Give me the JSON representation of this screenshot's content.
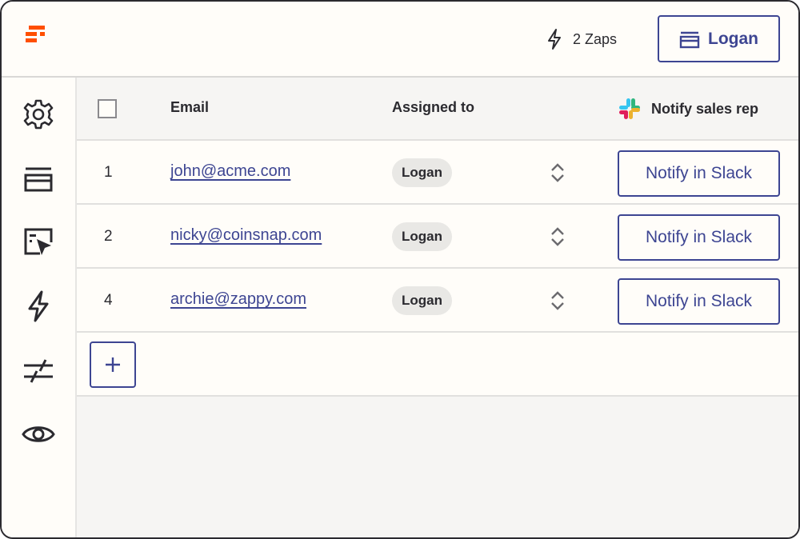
{
  "header": {
    "zaps_label": "2 Zaps",
    "user_label": "Logan",
    "brand_color": "#ff4f00",
    "accent_color": "#3d4592"
  },
  "sidebar": {
    "items": [
      {
        "icon": "gear-icon"
      },
      {
        "icon": "tables-icon"
      },
      {
        "icon": "interfaces-icon"
      },
      {
        "icon": "zap-icon"
      },
      {
        "icon": "transfer-icon"
      },
      {
        "icon": "eye-icon"
      }
    ]
  },
  "table": {
    "columns": {
      "email": "Email",
      "assigned_to": "Assigned to",
      "notify": "Notify sales rep"
    },
    "rows": [
      {
        "num": "1",
        "email": "john@acme.com",
        "assigned": "Logan",
        "action": "Notify in Slack"
      },
      {
        "num": "2",
        "email": "nicky@coinsnap.com",
        "assigned": "Logan",
        "action": "Notify in Slack"
      },
      {
        "num": "4",
        "email": "archie@zappy.com",
        "assigned": "Logan",
        "action": "Notify in Slack"
      }
    ],
    "add_label": "+"
  }
}
